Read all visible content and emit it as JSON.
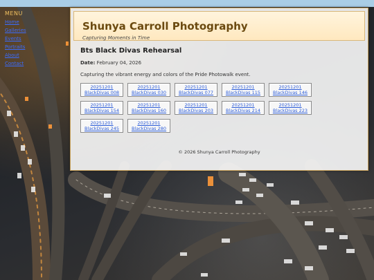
{
  "menu": {
    "title": "MENU",
    "items": [
      "Home",
      "Galleries",
      "Events",
      "Portraits",
      "About",
      "Contact"
    ]
  },
  "header": {
    "title": "Shunya Carroll Photography",
    "tagline": "Capturing Moments in Time"
  },
  "post": {
    "title": "Bts Black Divas Rehearsal",
    "date_label": "Date:",
    "date_value": "February 04, 2026",
    "description": "Capturing the vibrant energy and colors of the Pride Photowalk event."
  },
  "gallery": [
    {
      "line1": "20251201",
      "line2": "BlackDivas 008"
    },
    {
      "line1": "20251201",
      "line2": "BlackDivas 030"
    },
    {
      "line1": "20251201",
      "line2": "BlackDivas 077"
    },
    {
      "line1": "20251201",
      "line2": "BlackDivas 115"
    },
    {
      "line1": "20251201",
      "line2": "BlackDivas 146"
    },
    {
      "line1": "20251201",
      "line2": "BlackDivas 154"
    },
    {
      "line1": "20251201",
      "line2": "BlackDivas 160"
    },
    {
      "line1": "20251201",
      "line2": "BlackDivas 203"
    },
    {
      "line1": "20251201",
      "line2": "BlackDivas 214"
    },
    {
      "line1": "20251201",
      "line2": "BlackDivas 223"
    },
    {
      "line1": "20251201",
      "line2": "BlackDivas 245"
    },
    {
      "line1": "20251201",
      "line2": "BlackDivas 280"
    }
  ],
  "footer": {
    "text": "© 2026 Shunya Carroll Photography"
  },
  "colors": {
    "accent": "#6b4a10",
    "link": "#2a5bd8",
    "header_bg": "#ffe8bf"
  }
}
